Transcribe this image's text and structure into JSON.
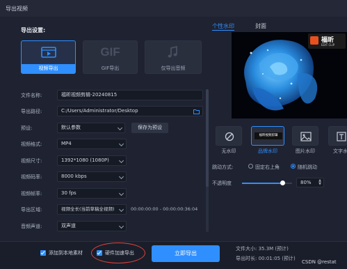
{
  "window": {
    "title": "导出视频"
  },
  "export_settings": {
    "heading": "导出设置:",
    "options": [
      {
        "label": "视频导出",
        "icon": "video-film-icon",
        "active": true
      },
      {
        "label": "GIF导出",
        "icon_text": "GIF",
        "icon": "gif-icon",
        "active": false
      },
      {
        "label": "仅导出音频",
        "icon": "music-note-icon",
        "active": false
      }
    ]
  },
  "form": {
    "filename": {
      "label": "文件名称:",
      "value": "福昕视频剪辑-20240815"
    },
    "path": {
      "label": "导出路径:",
      "value": "C:/Users/Administrator/Desktop"
    },
    "preset": {
      "label": "预设:",
      "value": "默认参数",
      "save_button": "保存为预设"
    },
    "format": {
      "label": "视频格式:",
      "value": "MP4"
    },
    "size": {
      "label": "视频尺寸:",
      "value": "1392*1080 (1080P)"
    },
    "bitrate": {
      "label": "视频码率:",
      "value": "8000 kbps"
    },
    "framerate": {
      "label": "视频帧率:",
      "value": "30 fps"
    },
    "region": {
      "label": "导出区域:",
      "value": "视频全长(当前草稿全视频)",
      "time_range": "00:00:00:00 - 00:00:00:36:04"
    },
    "audio": {
      "label": "音频声道:",
      "value": "双声道"
    }
  },
  "right_panel": {
    "tabs": [
      "个性水印",
      "封面"
    ],
    "logo_text": "福昕",
    "logo_sub": "EDIT CLIP",
    "watermark_options": [
      "无水印",
      "品牌水印",
      "图片水印",
      "文字水印"
    ],
    "brand_thumb_text": "福昕视频剪辑",
    "motion_label": "跳动方式:",
    "motion_options": [
      "固定右上角",
      "随机跳动"
    ],
    "opacity_label": "不透明度",
    "opacity_value": "80%",
    "opacity_level": 0.8
  },
  "bottom": {
    "add_to_material": "添加到本地素材",
    "hw_accel": "硬件加速导出",
    "export_button": "立即导出",
    "file_size": "文件大小:  35.3M (预计)",
    "export_duration": "导出时长:  00:01:05 (预计)",
    "watermark": "CSDN @restat"
  },
  "colors": {
    "accent": "#2f8fff",
    "highlight_circle": "#e0433a"
  }
}
